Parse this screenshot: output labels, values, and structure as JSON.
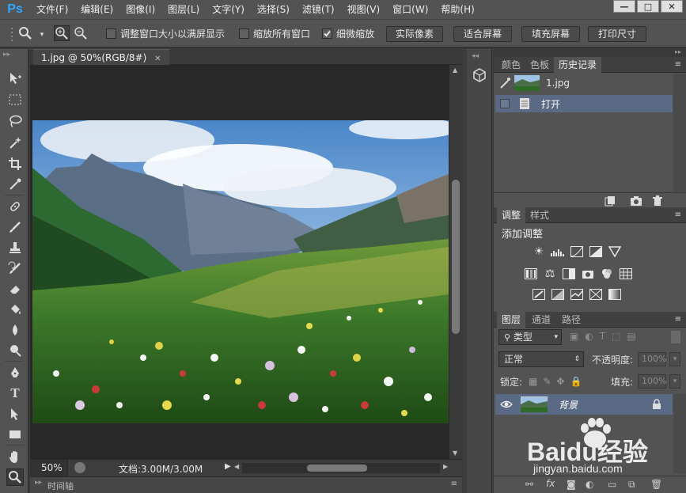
{
  "app": {
    "logo": "Ps"
  },
  "menu": [
    "文件(F)",
    "编辑(E)",
    "图像(I)",
    "图层(L)",
    "文字(Y)",
    "选择(S)",
    "滤镜(T)",
    "视图(V)",
    "窗口(W)",
    "帮助(H)"
  ],
  "window_controls": {
    "minimize": "—",
    "maximize": "□",
    "close": "✕"
  },
  "options": {
    "zoom_icon": "zoom-icon",
    "chk_resize_label": "调整窗口大小以满屏显示",
    "chk_resize_checked": false,
    "chk_all_windows_label": "缩放所有窗口",
    "chk_all_windows_checked": false,
    "chk_scrubby_label": "细微缩放",
    "chk_scrubby_checked": true,
    "btn_actual": "实际像素",
    "btn_fit": "适合屏幕",
    "btn_fill": "填充屏幕",
    "btn_print": "打印尺寸"
  },
  "document": {
    "tab_title": "1.jpg @ 50%(RGB/8#)",
    "tab_close": "✕",
    "zoom_level": "50%",
    "doc_size": "文档:3.00M/3.00M",
    "timeline_label": "时间轴"
  },
  "history_panel": {
    "tabs": [
      "颜色",
      "色板",
      "历史记录"
    ],
    "active_tab": "历史记录",
    "snapshot_name": "1.jpg",
    "items": [
      "打开"
    ]
  },
  "adjustments_panel": {
    "tabs": [
      "调整",
      "样式"
    ],
    "active_tab": "调整",
    "title": "添加调整"
  },
  "layers_panel": {
    "tabs": [
      "图层",
      "通道",
      "路径"
    ],
    "active_tab": "图层",
    "filter_kind": "类型",
    "blend_mode": "正常",
    "opacity_label": "不透明度:",
    "opacity_value": "100%",
    "lock_label": "锁定:",
    "fill_label": "填充:",
    "fill_value": "100%",
    "layers": [
      {
        "name": "背景",
        "visible": true,
        "locked": true
      }
    ]
  },
  "watermark": {
    "brand": "Baidu经验",
    "url": "jingyan.baidu.com"
  },
  "colors": {
    "accent": "#31a8ff",
    "panel": "#535353",
    "dark": "#282828",
    "selected": "#5a6a85"
  }
}
